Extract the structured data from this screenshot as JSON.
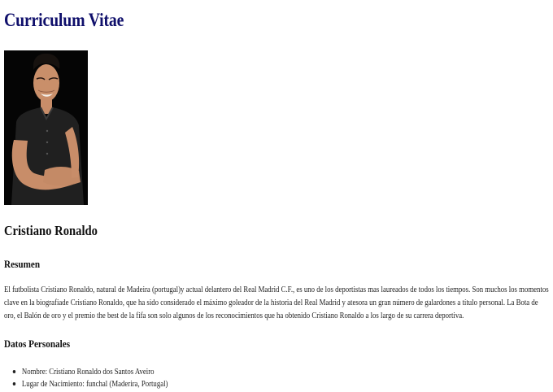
{
  "page": {
    "title": "Curriculum Vitae",
    "photo": "portrait-photo"
  },
  "profile": {
    "name": "Cristiano Ronaldo"
  },
  "summary": {
    "heading": "Resumen",
    "text": "El futbolista Cristiano Ronaldo, natural de Madeira (portugal)y actual delantero del Real Madrid C.F., es uno de los deportistas mas laureados de todos los tiempos. Son muchos los momentos clave en la biografiade Cristiano Ronaldo, que ha sido considerado el máximo goleador de la historia del Real Madrid y atesora un gran número de galardones a título personal. La Bota de oro, el Balón de oro y el premio the best de la fifa son solo algunos de los reconocimientos que ha obtenido Cristiano Ronaldo a los largo de su carrera deportiva."
  },
  "personal": {
    "heading": "Datos Personales",
    "items": [
      "Nombre: Cristiano Ronaldo dos Santos Aveiro",
      "Lugar de Nacimiento: funchal (Maderira, Portugal)"
    ]
  },
  "colors": {
    "title": "#0f0f6b",
    "text": "#111111",
    "photo_background": "#050505"
  }
}
